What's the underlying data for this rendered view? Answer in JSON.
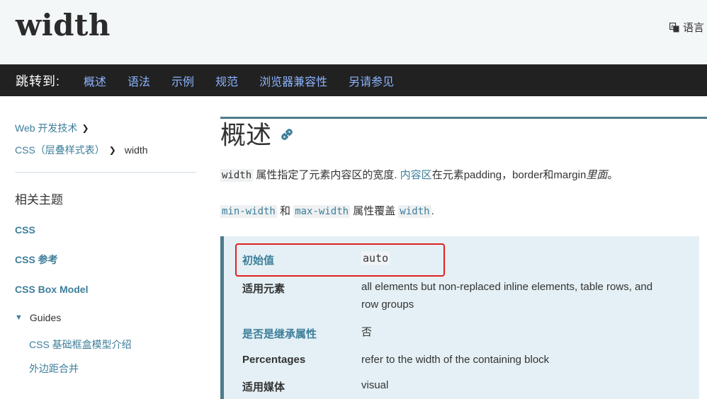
{
  "header": {
    "title": "width",
    "language_label": "语言"
  },
  "jumpbar": {
    "label": "跳转到:",
    "links": [
      "概述",
      "语法",
      "示例",
      "规范",
      "浏览器兼容性",
      "另请参见"
    ]
  },
  "sidebar": {
    "breadcrumbs": [
      "Web 开发技术",
      "CSS（层叠样式表）",
      "width"
    ],
    "related_title": "相关主题",
    "links": [
      "CSS",
      "CSS 参考",
      "CSS Box Model"
    ],
    "guides_label": "Guides",
    "guide_items": [
      "CSS 基础框盒模型介绍",
      "外边距合并"
    ]
  },
  "main": {
    "section_title": "概述",
    "para1": {
      "code": "width",
      "text1": " 属性指定了元素内容区的宽度. ",
      "link": "内容区",
      "text2": "在元素padding，border和margin",
      "em": "里面",
      "text3": "。"
    },
    "para2": {
      "code1": "min-width",
      "and": " 和 ",
      "code2": "max-width",
      "text": " 属性覆盖 ",
      "code3": "width",
      "end": "."
    },
    "infobox": {
      "rows": [
        {
          "key": "初始值",
          "value": "auto"
        },
        {
          "key": "适用元素",
          "value": "all elements but non-replaced inline elements, table rows, and row groups"
        },
        {
          "key": "是否是继承属性",
          "value": "否"
        },
        {
          "key": "Percentages",
          "value": "refer to the width of the containing block"
        },
        {
          "key": "适用媒体",
          "value": "visual"
        }
      ]
    }
  },
  "colors": {
    "link": "#3d7e9a",
    "jumpbar_bg": "#212121",
    "jump_link": "#8cb4ff",
    "highlight": "#e0201e",
    "infobox_bg": "#e4f0f5"
  }
}
